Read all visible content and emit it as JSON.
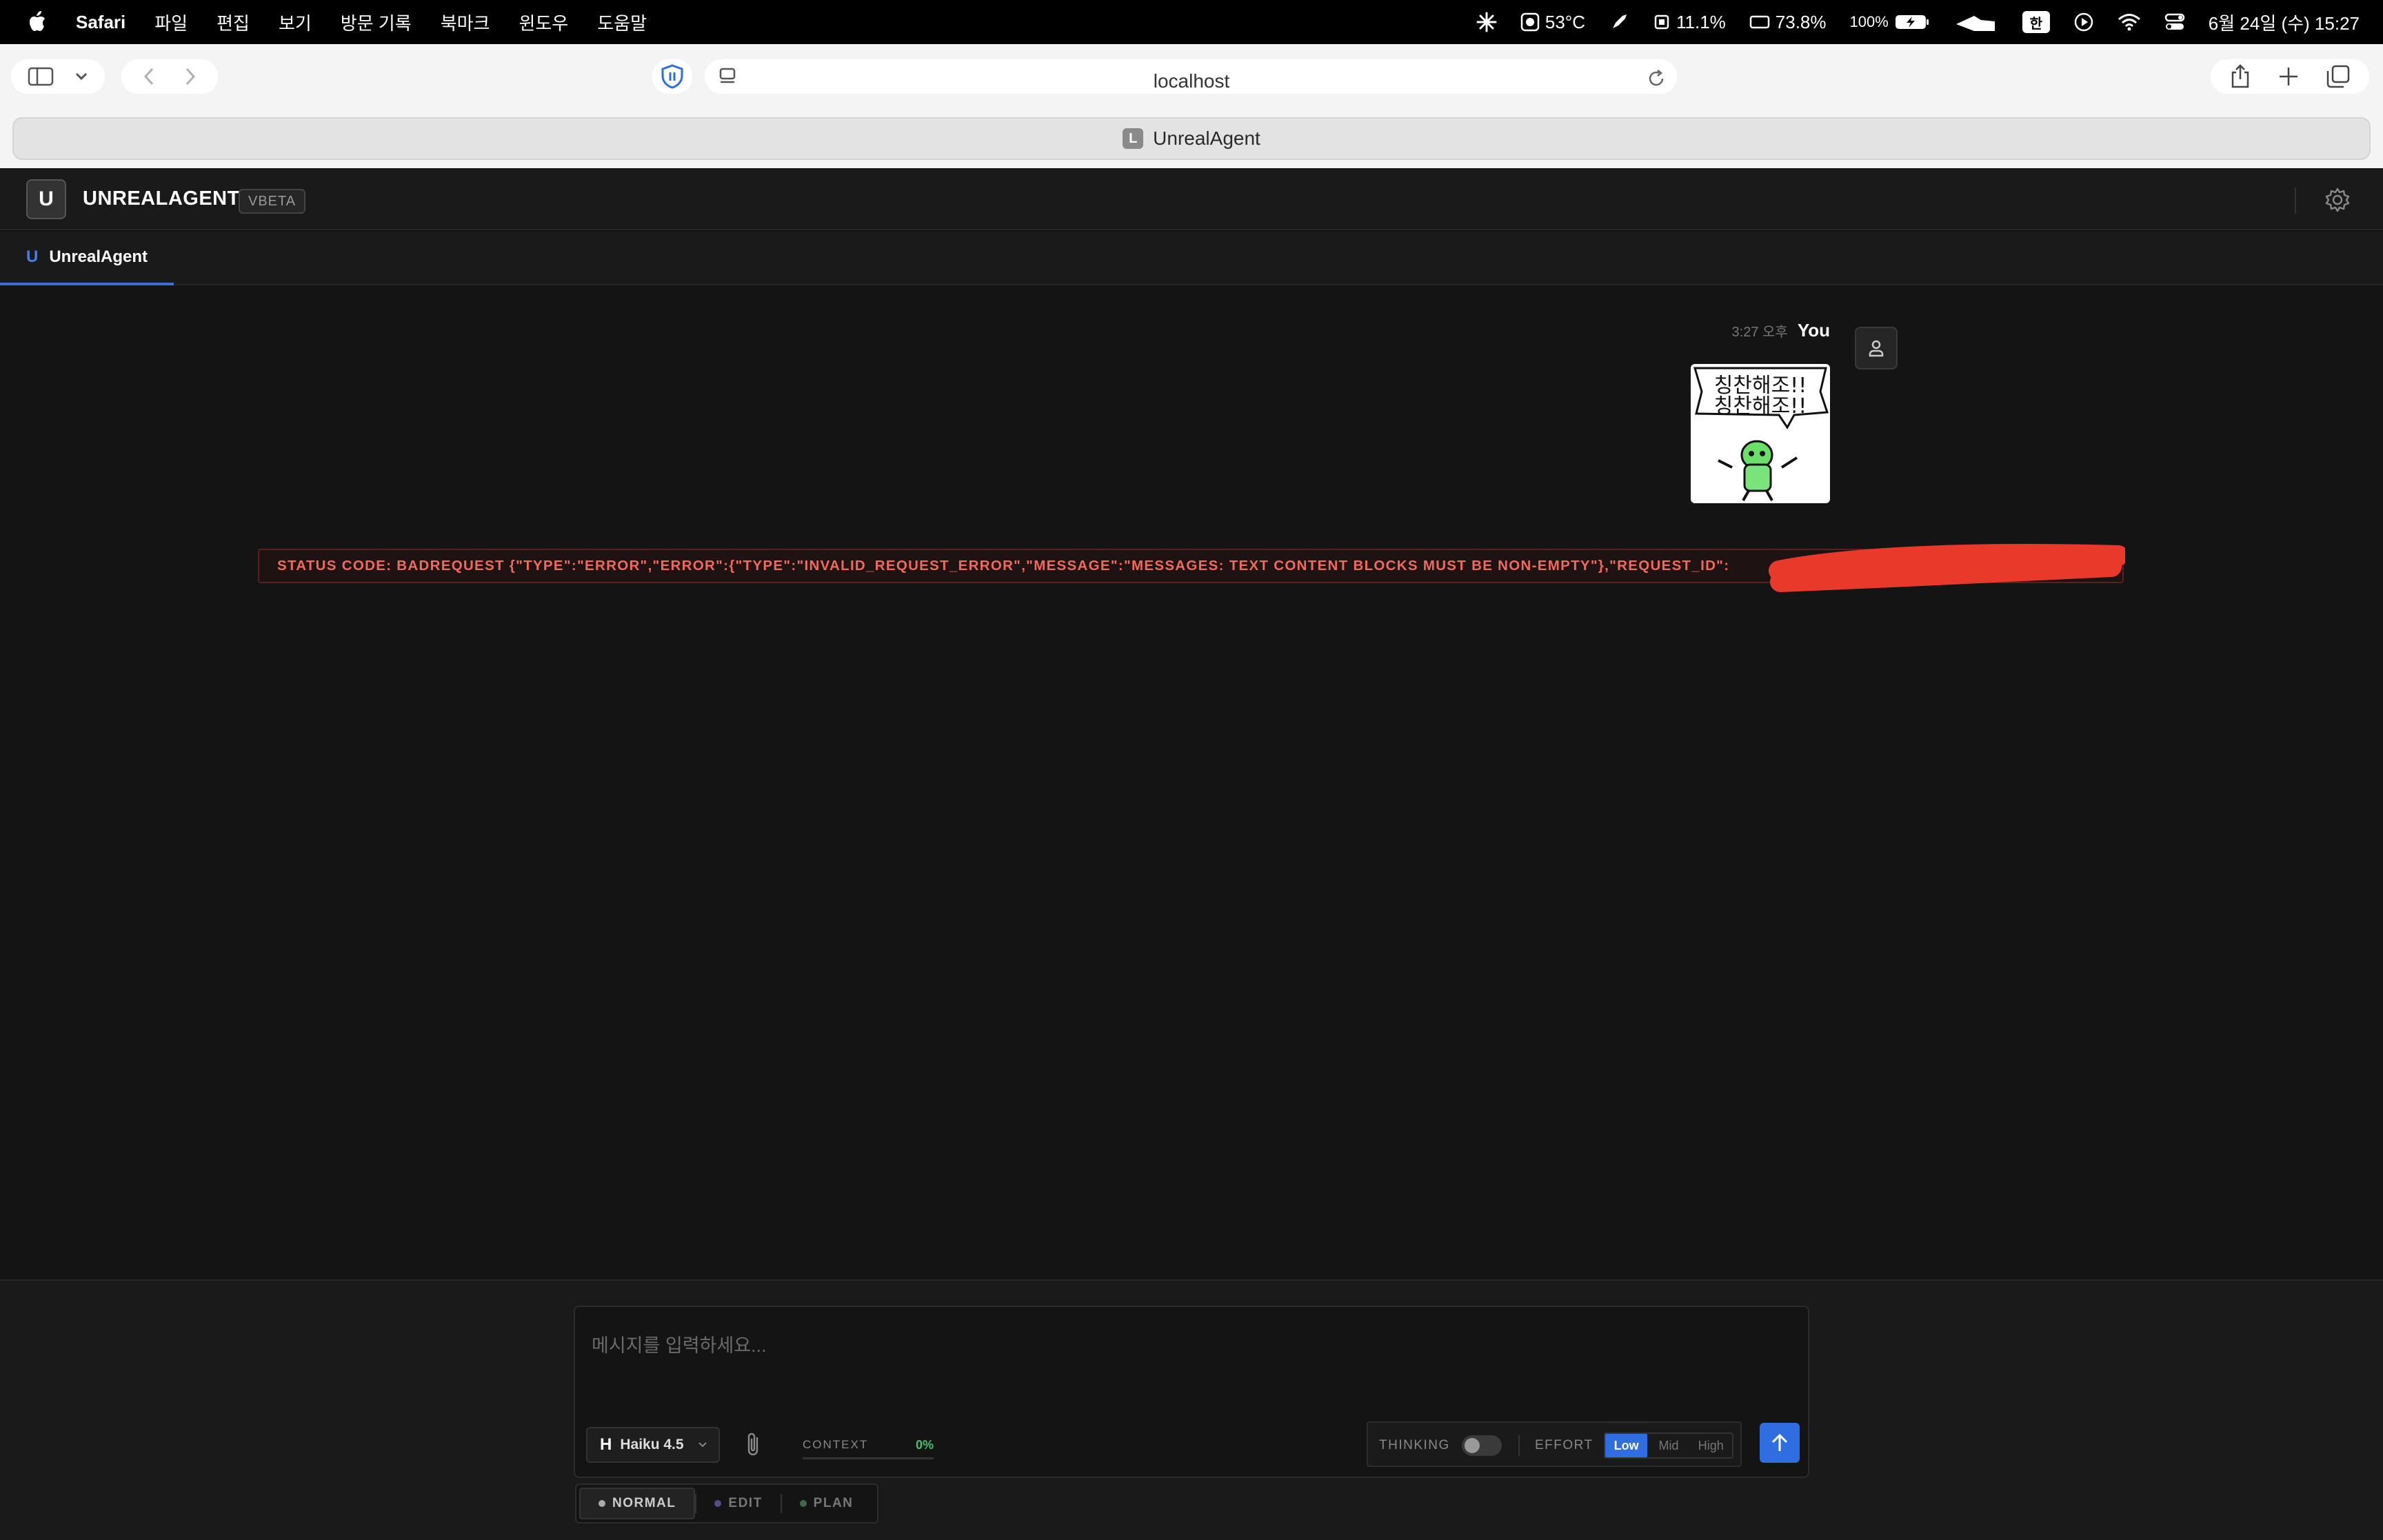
{
  "menubar": {
    "app": "Safari",
    "items": [
      "파일",
      "편집",
      "보기",
      "방문 기록",
      "북마크",
      "윈도우",
      "도움말"
    ],
    "temperature": "53°C",
    "cpu": "11.1%",
    "memory": "73.8%",
    "battery": "100%",
    "input_method": "한",
    "datetime": "6월 24일 (수) 15:27"
  },
  "safari": {
    "address": "localhost",
    "tab_title": "UnrealAgent",
    "tab_favicon": "L"
  },
  "app": {
    "logo": "U",
    "name": "UNREALAGENT",
    "badge": "VBETA",
    "tab_icon": "U",
    "tab_label": "UnrealAgent"
  },
  "chat": {
    "message": {
      "time": "3:27 오후",
      "author": "You",
      "sticker_text": [
        "칭찬해조!!",
        "칭찬해조!!"
      ]
    },
    "error": "STATUS CODE: BADREQUEST {\"TYPE\":\"ERROR\",\"ERROR\":{\"TYPE\":\"INVALID_REQUEST_ERROR\",\"MESSAGE\":\"MESSAGES: TEXT CONTENT BLOCKS MUST BE NON-EMPTY\"},\"REQUEST_ID\":"
  },
  "composer": {
    "placeholder": "메시지를 입력하세요...",
    "model_icon": "H",
    "model": "Haiku 4.5",
    "context_label": "CONTEXT",
    "context_value": "0%",
    "thinking_label": "THINKING",
    "effort_label": "EFFORT",
    "effort_options": [
      "Low",
      "Mid",
      "High"
    ],
    "modes": [
      "NORMAL",
      "EDIT",
      "PLAN"
    ]
  },
  "colors": {
    "accent": "#2f6ee0",
    "error_text": "#f16a5c",
    "context_ok": "#47c06b",
    "background": "#141414"
  }
}
